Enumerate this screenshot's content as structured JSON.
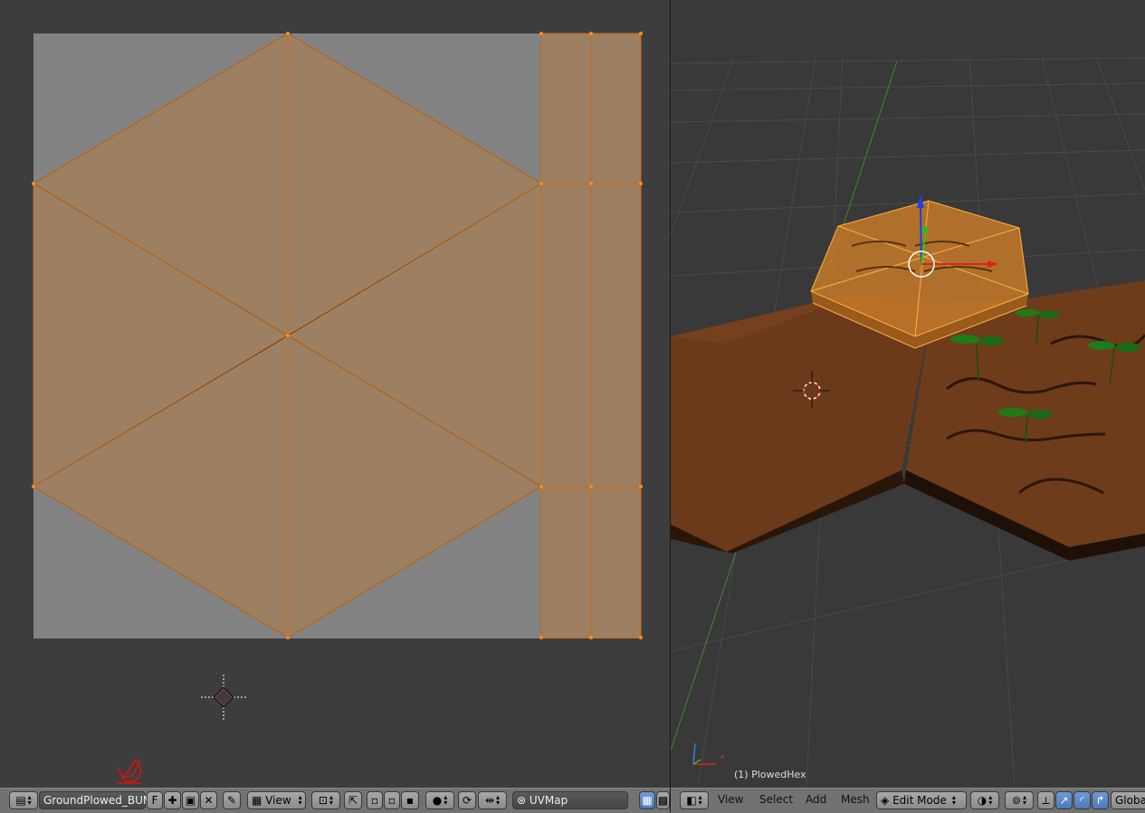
{
  "uv_editor": {
    "image_name": "GroundPlowed_BUMP",
    "fake_user_label": "F",
    "view_menu": "View",
    "uv_map": "UVMap",
    "icons": [
      "image-editor-icon",
      "new-image-icon",
      "open-image-icon",
      "unlink-image-icon",
      "pin-icon",
      "display-image-icon",
      "snap-pivot-icon",
      "uv-select-icon",
      "vertex-select-icon",
      "edge-select-icon",
      "face-select-icon",
      "proportional-icon",
      "sync-icon",
      "sticky-icon",
      "uv-map-icon",
      "texture-paint-icon",
      "checker-icon"
    ]
  },
  "viewport": {
    "object_label": "(1) PlowedHex",
    "menus": [
      "View",
      "Select",
      "Add",
      "Mesh"
    ],
    "mode": "Edit Mode",
    "orientation": "Global",
    "axis_x_label": "x",
    "icons": [
      "3d-view-icon",
      "mode-icon",
      "shading-icon",
      "pivot-icon",
      "manipulator-icon",
      "translate-icon",
      "rotate-icon",
      "scale-icon"
    ]
  },
  "colors": {
    "uv_face": "#9d8062",
    "uv_edge": "#e07a18",
    "texture_bg": "#838383",
    "selected_object": "#f5a030",
    "ground": "#6b3a1a"
  }
}
